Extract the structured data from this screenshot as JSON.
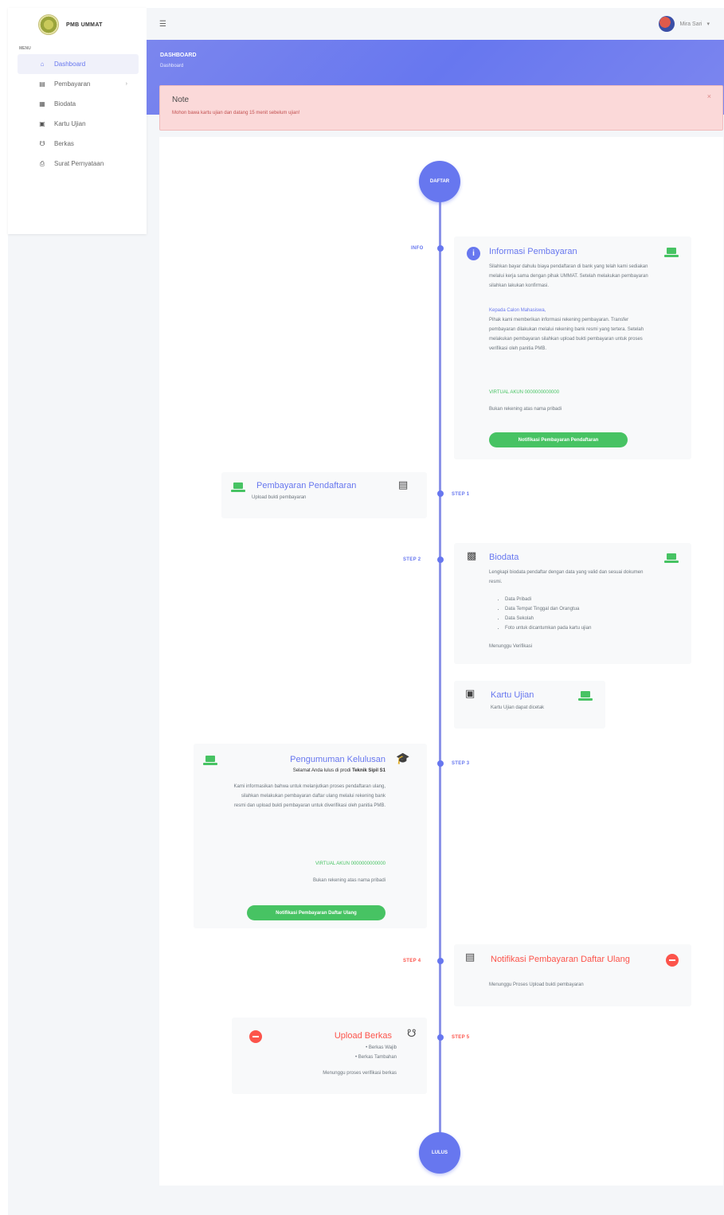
{
  "brand": {
    "name": "PMB UMMAT"
  },
  "sidebar": {
    "heading": "MENU",
    "items": [
      {
        "label": "Dashboard",
        "icon": "home-icon"
      },
      {
        "label": "Pembayaran",
        "icon": "card-icon"
      },
      {
        "label": "Biodata",
        "icon": "id-icon"
      },
      {
        "label": "Kartu Ujian",
        "icon": "card-id-icon"
      },
      {
        "label": "Berkas",
        "icon": "files-icon"
      },
      {
        "label": "Surat Pernyataan",
        "icon": "print-icon"
      }
    ]
  },
  "topbar": {
    "user_name": "Mira Sari"
  },
  "header": {
    "title": "DASHBOARD",
    "subtitle": "Dashboard"
  },
  "alert": {
    "title": "Note",
    "text": "Mohon bawa kartu ujian dan datang 15 menit sebelum ujian!"
  },
  "timeline": {
    "start": "DAFTAR",
    "end": "LULUS",
    "steps": {
      "info": {
        "label": "INFO",
        "title": "Informasi Pembayaran",
        "p1": "Silahkan bayar dahulu biaya pendaftaran di bank yang telah kami sediakan melalui kerja sama dengan pihak UMMAT. Setelah melakukan pembayaran silahkan lakukan konfirmasi.",
        "p2_title": "Kepada Calon Mahasiswa,",
        "p2": "Pihak kami memberikan informasi rekening pembayaran. Transfer pembayaran dilakukan melalui rekening bank resmi yang tertera. Setelah melakukan pembayaran silahkan upload bukti pembayaran untuk proses verifikasi oleh panitia PMB.",
        "virtual_account": "VIRTUAL AKUN 0000000000000",
        "note": "Bukan rekening atas nama pribadi",
        "button": "Notifikasi Pembayaran Pendaftaran"
      },
      "step1": {
        "label": "STEP 1",
        "title": "Pembayaran Pendaftaran",
        "text": "Upload bukti pembayaran"
      },
      "step2": {
        "label": "STEP 2",
        "title": "Biodata",
        "intro": "Lengkapi biodata pendaftar dengan data yang valid dan sesuai dokumen resmi.",
        "bullets": [
          "Data Pribadi",
          "Data Tempat Tinggal dan Orangtua",
          "Data Sekolah",
          "Foto untuk dicantumkan pada kartu ujian"
        ],
        "status": "Menunggu Verifikasi"
      },
      "kartu": {
        "title": "Kartu Ujian",
        "text": "Kartu Ujian dapat dicetak"
      },
      "step3": {
        "label": "STEP 3",
        "title": "Pengumuman Kelulusan",
        "line1_prefix": "Selamat Anda lulus di prodi",
        "line1_strong": "Teknik Sipil S1",
        "p1": "Kami informasikan bahwa untuk melanjutkan proses pendaftaran ulang, silahkan melakukan pembayaran daftar ulang melalui rekening bank resmi dan upload bukti pembayaran untuk diverifikasi oleh panitia PMB.",
        "virtual_account": "VIRTUAL AKUN 0000000000000",
        "note": "Bukan rekening atas nama pribadi",
        "button": "Notifikasi Pembayaran Daftar Ulang"
      },
      "step4": {
        "label": "STEP 4",
        "title": "Notifikasi Pembayaran Daftar Ulang",
        "text": "Menunggu Proses Upload bukti pembayaran"
      },
      "step5": {
        "label": "STEP 5",
        "title": "Upload Berkas",
        "bullets": [
          "Berkas Wajib",
          "Berkas Tambahan"
        ],
        "text": "Menunggu proses verifikasi berkas"
      }
    }
  },
  "colors": {
    "primary": "#6777ef",
    "success": "#47c363",
    "danger": "#fc544b"
  }
}
